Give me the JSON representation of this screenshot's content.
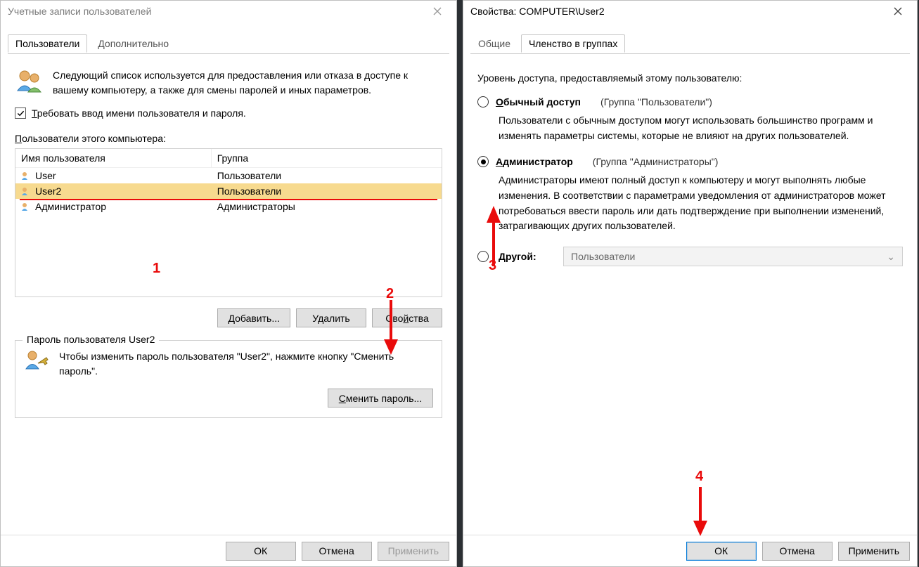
{
  "left": {
    "title": "Учетные записи пользователей",
    "tabs": {
      "users": "Пользователи",
      "advanced": "Дополнительно"
    },
    "info_text": "Следующий список используется для предоставления или отказа в доступе к вашему компьютеру, а также для смены паролей и иных параметров.",
    "checkbox_label_pre": "Т",
    "checkbox_label_rest": "ребовать ввод имени пользователя и пароля.",
    "list_label_pre": "П",
    "list_label_rest": "ользователи этого компьютера:",
    "columns": {
      "name": "Имя пользователя",
      "group": "Группа"
    },
    "rows": [
      {
        "name": "User",
        "group": "Пользователи"
      },
      {
        "name": "User2",
        "group": "Пользователи",
        "selected": true
      },
      {
        "name": "Администратор",
        "group": "Администраторы"
      }
    ],
    "buttons": {
      "add_pre": "Д",
      "add_rest": "обавить...",
      "delete": "Удалить",
      "props_pre": "Сво",
      "props_u": "й",
      "props_post": "ства"
    },
    "password_box": {
      "legend": "Пароль пользователя User2",
      "text": "Чтобы изменить пароль пользователя \"User2\", нажмите кнопку \"Сменить пароль\".",
      "btn_pre": "С",
      "btn_rest": "менить пароль..."
    },
    "footer": {
      "ok": "ОК",
      "cancel": "Отмена",
      "apply": "Применить"
    }
  },
  "right": {
    "title": "Свойства: COMPUTER\\User2",
    "tabs": {
      "general": "Общие",
      "membership": "Членство в группах"
    },
    "access_label": "Уровень доступа, предоставляемый этому пользователю:",
    "opt_normal": {
      "name_pre": "О",
      "name_rest": "бычный доступ",
      "group": "(Группа \"Пользователи\")",
      "desc": "Пользователи с обычным доступом могут использовать большинство программ и изменять параметры системы, которые не влияют на других пользователей."
    },
    "opt_admin": {
      "name_pre": "А",
      "name_rest": "дминистратор",
      "group": "(Группа \"Администраторы\")",
      "desc": "Администраторы имеют полный доступ к компьютеру и могут выполнять любые изменения. В соответствии с параметрами уведомления от администраторов может потребоваться ввести пароль или дать подтверждение при выполнении изменений, затрагивающих других пользователей."
    },
    "opt_other": {
      "name_pre": "Д",
      "name_rest": "ругой:",
      "combo": "Пользователи"
    },
    "footer": {
      "ok": "ОК",
      "cancel": "Отмена",
      "apply": "Применить"
    }
  },
  "annotations": {
    "n1": "1",
    "n2": "2",
    "n3": "3",
    "n4": "4"
  }
}
